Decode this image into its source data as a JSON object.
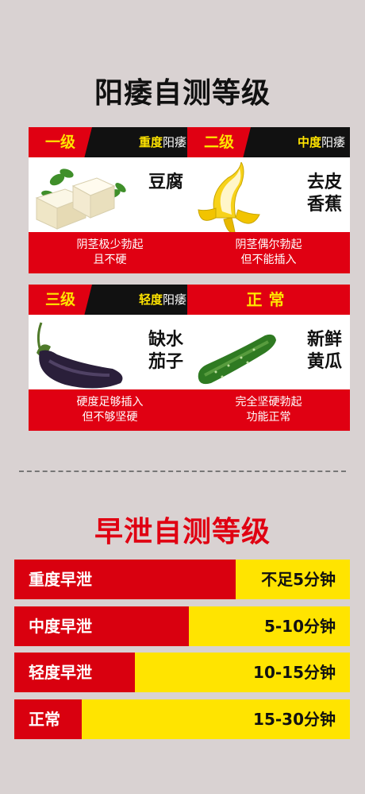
{
  "ed_section": {
    "title": "阳痿自测等级",
    "cards": [
      {
        "level": "一级",
        "severity_bold": "重度",
        "severity_rest": "阳痿",
        "food_line1": "豆腐",
        "food_line2": "",
        "desc_line1": "阴茎极少勃起",
        "desc_line2": "且不硬",
        "image": "tofu-image"
      },
      {
        "level": "二级",
        "severity_bold": "中度",
        "severity_rest": "阳痿",
        "food_line1": "去皮",
        "food_line2": "香蕉",
        "desc_line1": "阴茎偶尔勃起",
        "desc_line2": "但不能插入",
        "image": "banana-image"
      },
      {
        "level": "三级",
        "severity_bold": "轻度",
        "severity_rest": "阳痿",
        "food_line1": "缺水",
        "food_line2": "茄子",
        "desc_line1": "硬度足够插入",
        "desc_line2": "但不够坚硬",
        "image": "eggplant-image"
      },
      {
        "level": "正常",
        "severity_bold": "",
        "severity_rest": "",
        "food_line1": "新鲜",
        "food_line2": "黄瓜",
        "desc_line1": "完全坚硬勃起",
        "desc_line2": "功能正常",
        "image": "cucumber-image"
      }
    ]
  },
  "pe_section": {
    "title": "早泄自测等级",
    "bars": [
      {
        "label": "重度早泄",
        "time": "不足5分钟",
        "red_fraction": 0.66
      },
      {
        "label": "中度早泄",
        "time": "5-10分钟",
        "red_fraction": 0.52
      },
      {
        "label": "轻度早泄",
        "time": "10-15分钟",
        "red_fraction": 0.36
      },
      {
        "label": "正常",
        "time": "15-30分钟",
        "red_fraction": 0.2
      }
    ]
  },
  "colors": {
    "red": "#e00012",
    "yellow": "#ffe400",
    "black": "#111111",
    "background": "#d9d2d2"
  }
}
